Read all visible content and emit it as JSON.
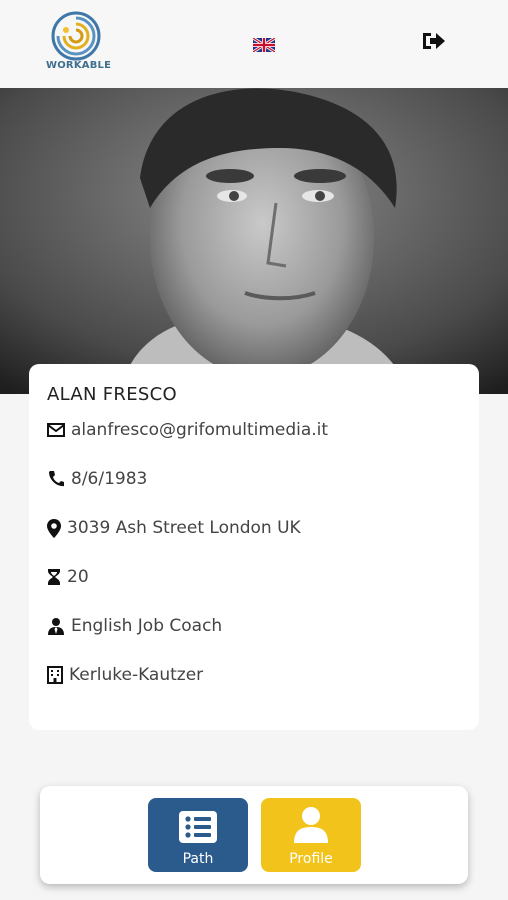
{
  "header": {
    "logo_text": "WORKABLE",
    "language_flag": "uk-flag-icon",
    "logout_icon": "logout-icon"
  },
  "profile": {
    "name": "ALAN FRESCO",
    "email": "alanfresco@grifomultimedia.it",
    "phone": "8/6/1983",
    "address": "3039 Ash Street London UK",
    "hours": "20",
    "role": "English Job Coach",
    "company": "Kerluke-Kautzer"
  },
  "nav": {
    "path_label": "Path",
    "profile_label": "Profile"
  },
  "colors": {
    "path_button": "#2b5b8c",
    "profile_button": "#f2c41b",
    "logo_text": "#3f6f8f"
  }
}
